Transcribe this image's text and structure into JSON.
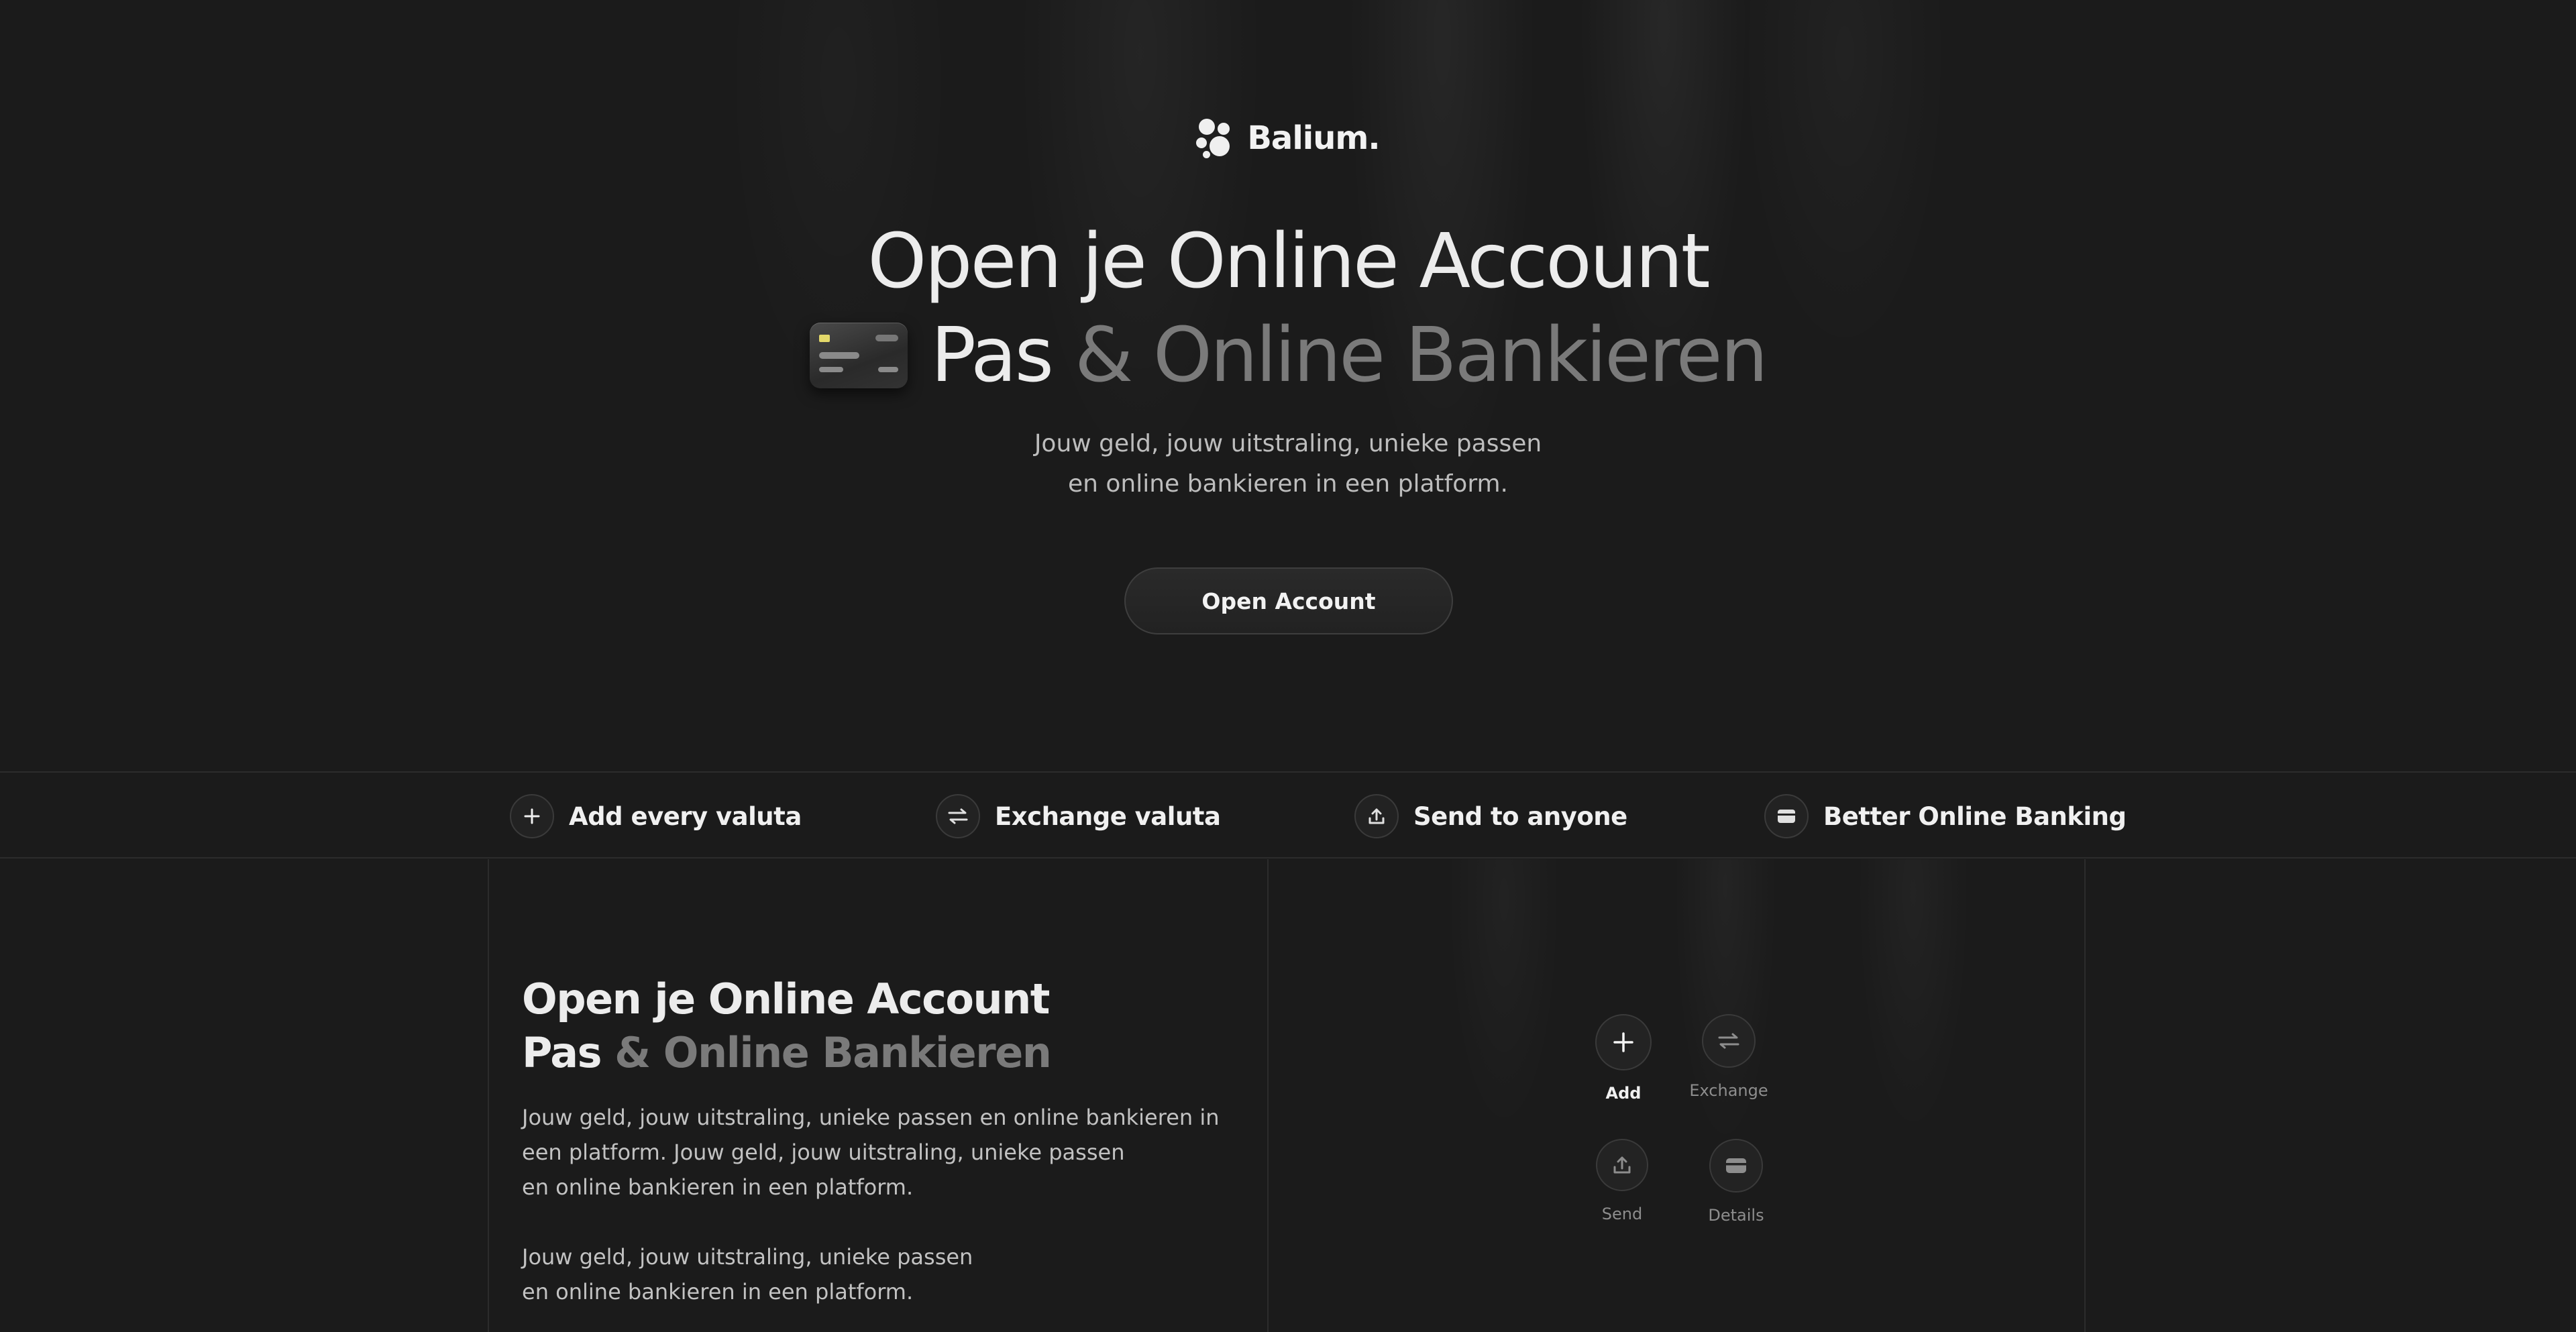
{
  "brand": {
    "name": "Balium.",
    "logo_icon": "balium-dots-logo"
  },
  "hero": {
    "title_line1": "Open je Online Account",
    "title_line2_strong": "Pas",
    "title_line2_muted": "& Online Bankieren",
    "card_icon": "bank-card-icon",
    "subtitle_line1": "Jouw geld, jouw uitstraling, unieke passen",
    "subtitle_line2": "en online bankieren in een platform.",
    "cta_label": "Open Account"
  },
  "features": [
    {
      "label": "Add every valuta",
      "icon": "plus-icon"
    },
    {
      "label": "Exchange valuta",
      "icon": "exchange-arrows-icon"
    },
    {
      "label": "Send to anyone",
      "icon": "upload-send-icon"
    },
    {
      "label": "Better Online Banking",
      "icon": "card-icon"
    }
  ],
  "section": {
    "title_line1": "Open je Online Account",
    "title_line2_strong": "Pas",
    "title_line2_muted": "& Online Bankieren",
    "body1_line1": "Jouw geld, jouw uitstraling, unieke passen en online bankieren in",
    "body1_line2": "een platform. Jouw geld, jouw uitstraling, unieke passen",
    "body1_line3": "en online bankieren in een platform.",
    "body2_line1": "Jouw geld, jouw uitstraling, unieke passen",
    "body2_line2": "en online bankieren in een platform."
  },
  "actions": [
    {
      "label": "Add",
      "icon": "plus-icon",
      "active": true
    },
    {
      "label": "Exchange",
      "icon": "exchange-arrows-icon",
      "active": false
    },
    {
      "label": "Send",
      "icon": "upload-send-icon",
      "active": false
    },
    {
      "label": "Details",
      "icon": "card-icon",
      "active": false
    }
  ],
  "colors": {
    "background": "#1b1b1b",
    "text_primary": "#ececec",
    "text_muted": "#7a7a7a",
    "border": "#2c2c2c"
  }
}
